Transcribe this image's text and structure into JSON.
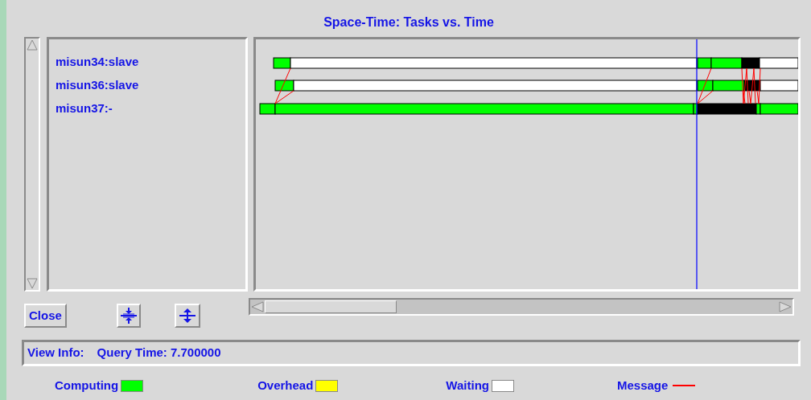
{
  "window": {
    "title": "Space-Time: Tasks vs. Time"
  },
  "tasks": [
    {
      "label": "misun34:slave"
    },
    {
      "label": "misun36:slave"
    },
    {
      "label": "misun37:-"
    }
  ],
  "buttons": {
    "close": "Close"
  },
  "view_info": {
    "label": "View Info:",
    "value": "Query Time: 7.700000"
  },
  "legend": [
    {
      "label": "Computing",
      "kind": "swatch",
      "color": "#00ff00"
    },
    {
      "label": "Overhead",
      "kind": "swatch",
      "color": "#ffff00"
    },
    {
      "label": "Waiting",
      "kind": "swatch",
      "color": "#ffffff"
    },
    {
      "label": "Message",
      "kind": "line",
      "color": "#ff0000"
    }
  ]
}
